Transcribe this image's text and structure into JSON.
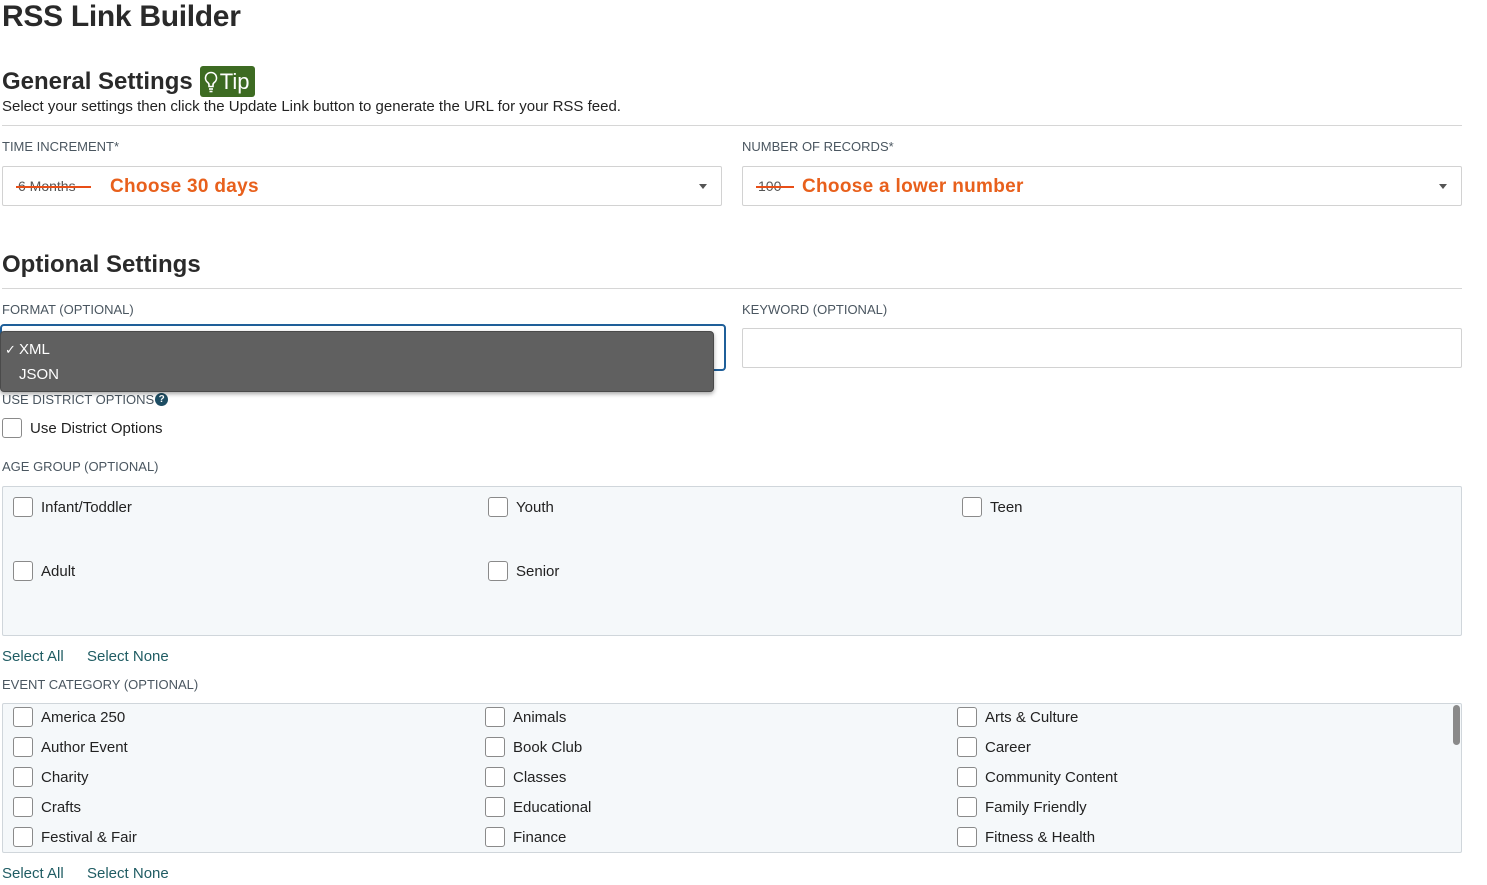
{
  "page": {
    "title": "RSS Link Builder"
  },
  "general": {
    "title": "General Settings",
    "tip_label": "Tip",
    "description": "Select your settings then click the Update Link button to generate the URL for your RSS feed.",
    "time_increment": {
      "label": "TIME INCREMENT*",
      "struck_value": "6 Months",
      "hint": "Choose 30 days"
    },
    "num_records": {
      "label": "NUMBER OF RECORDS*",
      "struck_value": "100",
      "hint": "Choose a lower number"
    }
  },
  "optional": {
    "title": "Optional Settings",
    "format": {
      "label": "FORMAT (OPTIONAL)",
      "options": [
        "XML",
        "JSON"
      ],
      "selected": "XML",
      "check": "✓"
    },
    "keyword": {
      "label": "KEYWORD (OPTIONAL)",
      "value": ""
    },
    "district": {
      "label": "USE DISTRICT OPTIONS",
      "help": "?",
      "checkbox_label": "Use District Options"
    },
    "age_group": {
      "label": "AGE GROUP (OPTIONAL)",
      "items": [
        "Infant/Toddler",
        "Youth",
        "Teen",
        "Adult",
        "Senior"
      ],
      "select_all": "Select All",
      "select_none": "Select None"
    },
    "event_category": {
      "label": "EVENT CATEGORY (OPTIONAL)",
      "items": [
        "America 250",
        "Animals",
        "Arts & Culture",
        "Author Event",
        "Book Club",
        "Career",
        "Charity",
        "Classes",
        "Community Content",
        "Crafts",
        "Educational",
        "Family Friendly",
        "Festival & Fair",
        "Finance",
        "Fitness & Health"
      ],
      "select_all": "Select All",
      "select_none": "Select None"
    }
  },
  "colors": {
    "tip_bg": "#3d6b22",
    "hint": "#e8601c",
    "strike": "#e84e17",
    "focus": "#1f5f99",
    "link": "#1f5c63"
  }
}
